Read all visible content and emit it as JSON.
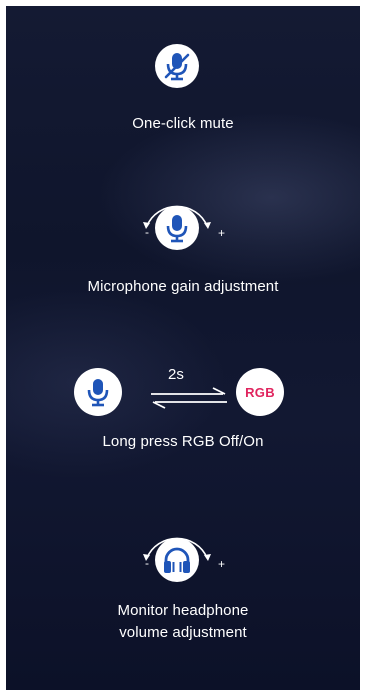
{
  "features": {
    "mute": {
      "label": "One-click mute",
      "icon": "muted-microphone-icon"
    },
    "gain": {
      "label": "Microphone gain adjustment",
      "icon": "microphone-icon",
      "minus": "-",
      "plus": "+"
    },
    "rgb": {
      "label": "Long press RGB Off/On",
      "duration": "2s",
      "badge": "RGB",
      "icon": "microphone-icon"
    },
    "monitor": {
      "label_line1": "Monitor headphone",
      "label_line2": "volume adjustment",
      "icon": "headphone-icon",
      "minus": "-",
      "plus": "+"
    }
  },
  "colors": {
    "background": "#11172f",
    "icon_blue": "#1f55b8",
    "rgb_red": "#e0245e",
    "text": "#ffffff"
  }
}
